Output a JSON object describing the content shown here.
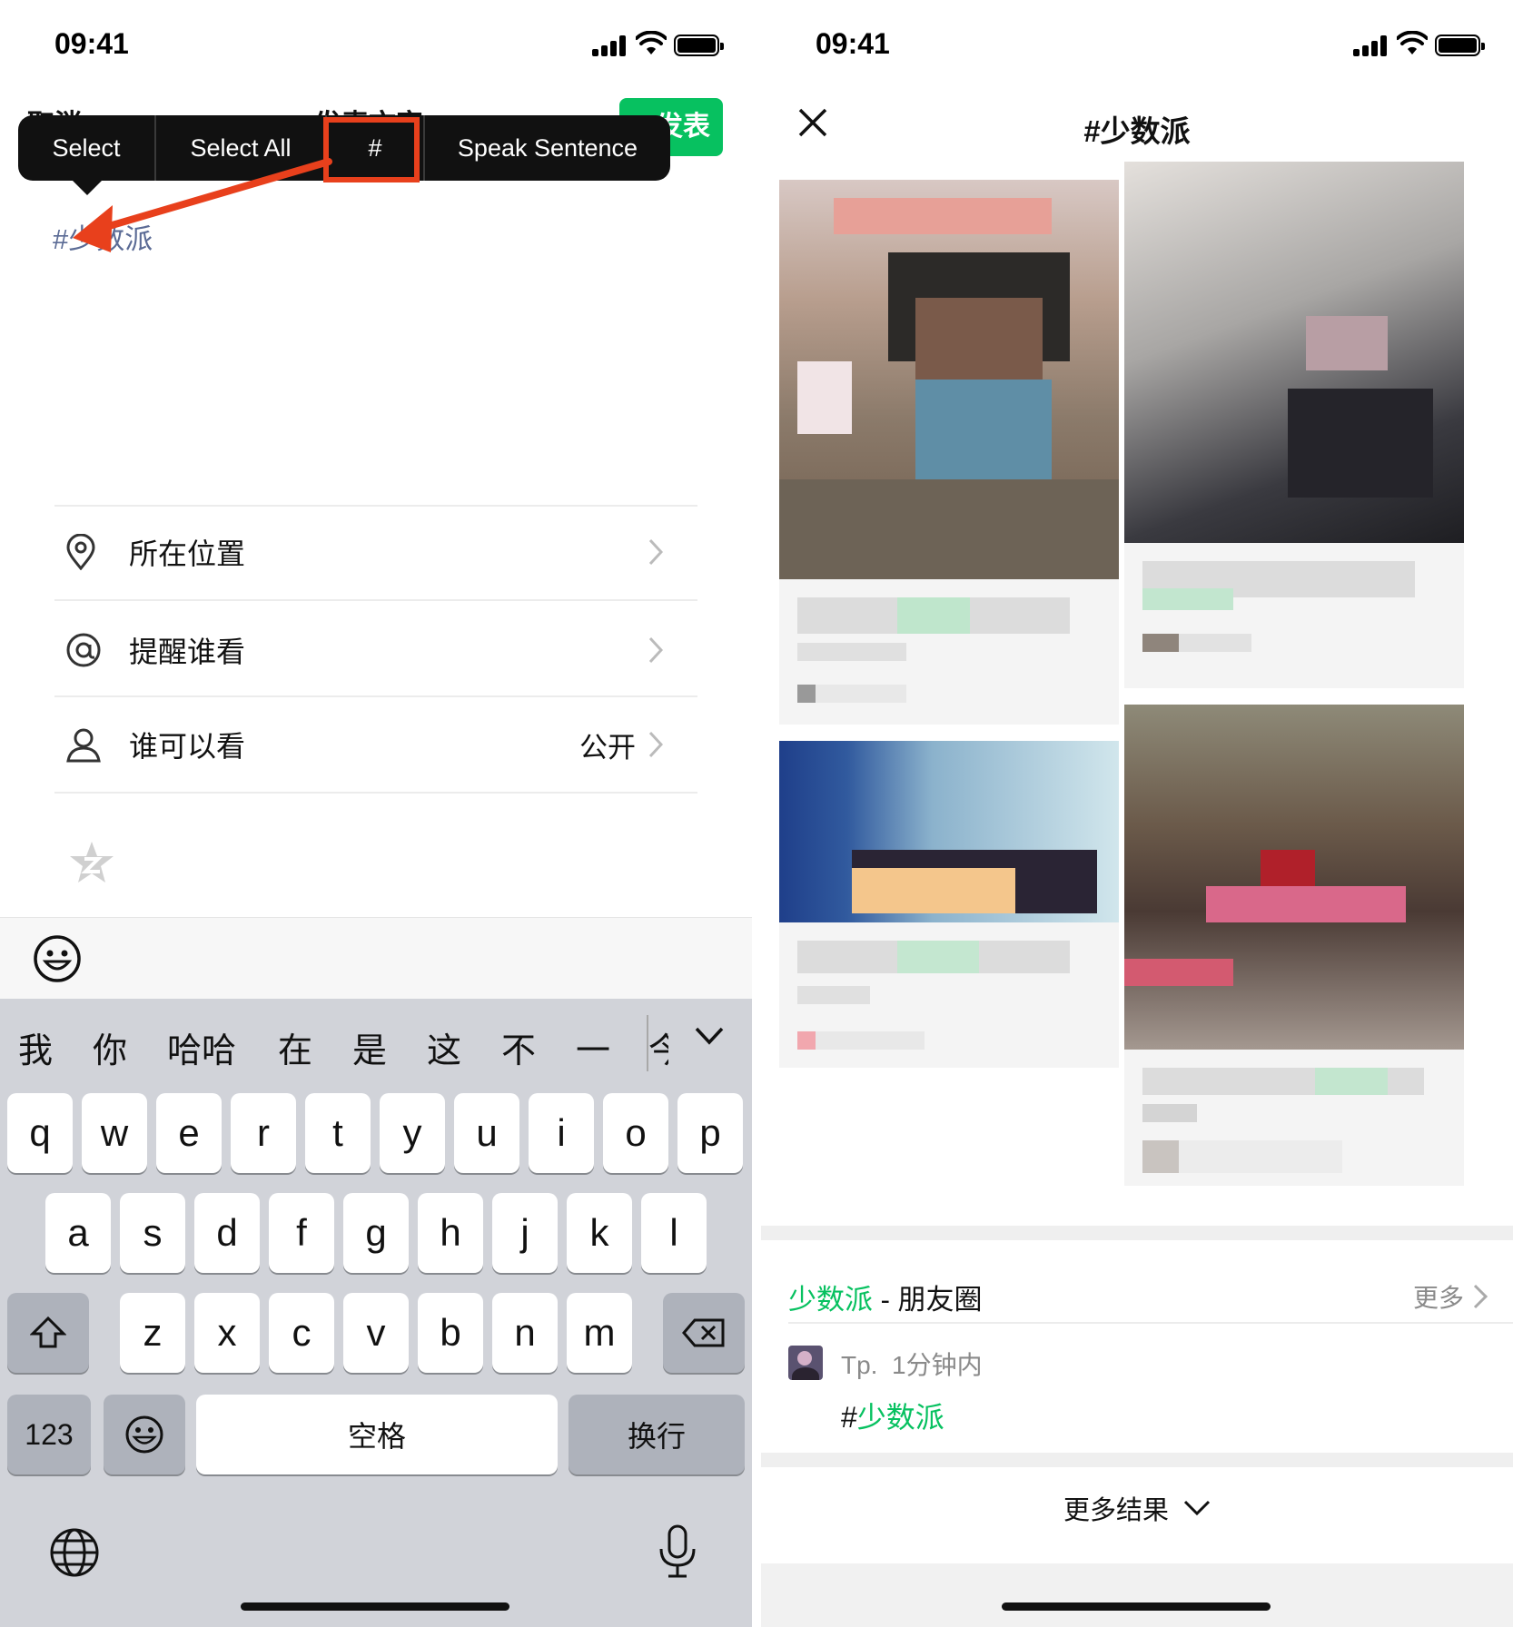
{
  "status_bar": {
    "time": "09:41"
  },
  "left": {
    "header_ghost": {
      "cancel": "取消",
      "title": "发表文字",
      "post": "发表"
    },
    "edit_menu": {
      "items": [
        "Select",
        "Select All",
        "#",
        "Speak Sentence"
      ],
      "highlight_color": "#e8401c"
    },
    "post_text": "#少数派",
    "options": [
      {
        "label": "所在位置",
        "value": "",
        "icon": "location-pin-icon"
      },
      {
        "label": "提醒谁看",
        "value": "",
        "icon": "at-sign-icon"
      },
      {
        "label": "谁可以看",
        "value": "公开",
        "icon": "person-icon"
      }
    ],
    "favorite_icon": "star-icon",
    "keyboard": {
      "candidates": [
        "我",
        "你",
        "哈哈",
        "在",
        "是",
        "这",
        "不",
        "一",
        "今"
      ],
      "row1": [
        "q",
        "w",
        "e",
        "r",
        "t",
        "y",
        "u",
        "i",
        "o",
        "p"
      ],
      "row2": [
        "a",
        "s",
        "d",
        "f",
        "g",
        "h",
        "j",
        "k",
        "l"
      ],
      "row3": [
        "z",
        "x",
        "c",
        "v",
        "b",
        "n",
        "m"
      ],
      "numbers_key": "123",
      "space_key": "空格",
      "return_key": "换行"
    }
  },
  "right": {
    "title": "#少数派",
    "section": {
      "topic": "少数派",
      "suffix": " - 朋友圈",
      "more": "更多"
    },
    "moment": {
      "user": "Tp.",
      "time": "1分钟内",
      "hash": "#",
      "tag": "少数派"
    },
    "more_results": "更多结果"
  },
  "colors": {
    "wechat_green": "#07c160",
    "menu_bg": "#111111",
    "tag_blue": "#5b6b95"
  }
}
